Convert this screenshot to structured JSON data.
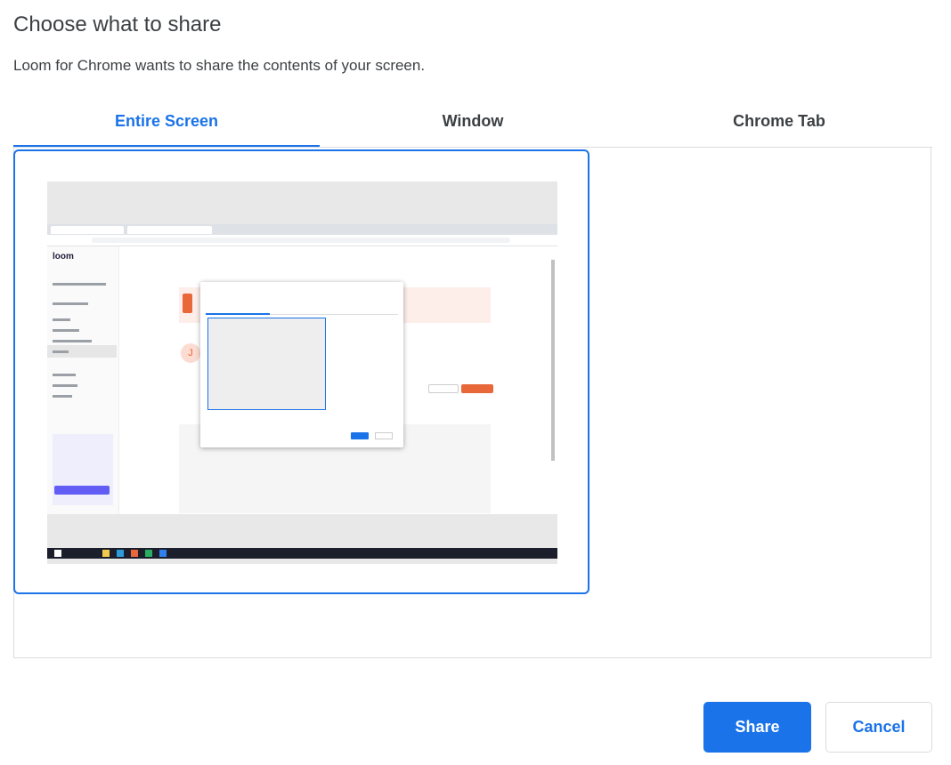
{
  "dialog": {
    "title": "Choose what to share",
    "subtitle": "Loom for Chrome wants to share the contents of your screen."
  },
  "tabs": [
    {
      "label": "Entire Screen",
      "active": true
    },
    {
      "label": "Window",
      "active": false
    },
    {
      "label": "Chrome Tab",
      "active": false
    }
  ],
  "preview": {
    "avatar_letter": "J",
    "app_logo_text": "loom"
  },
  "buttons": {
    "share_label": "Share",
    "cancel_label": "Cancel"
  },
  "colors": {
    "accent": "#1a73e8",
    "border": "#dadce0",
    "loom_orange": "#e8683a",
    "loom_purple": "#625df5"
  }
}
